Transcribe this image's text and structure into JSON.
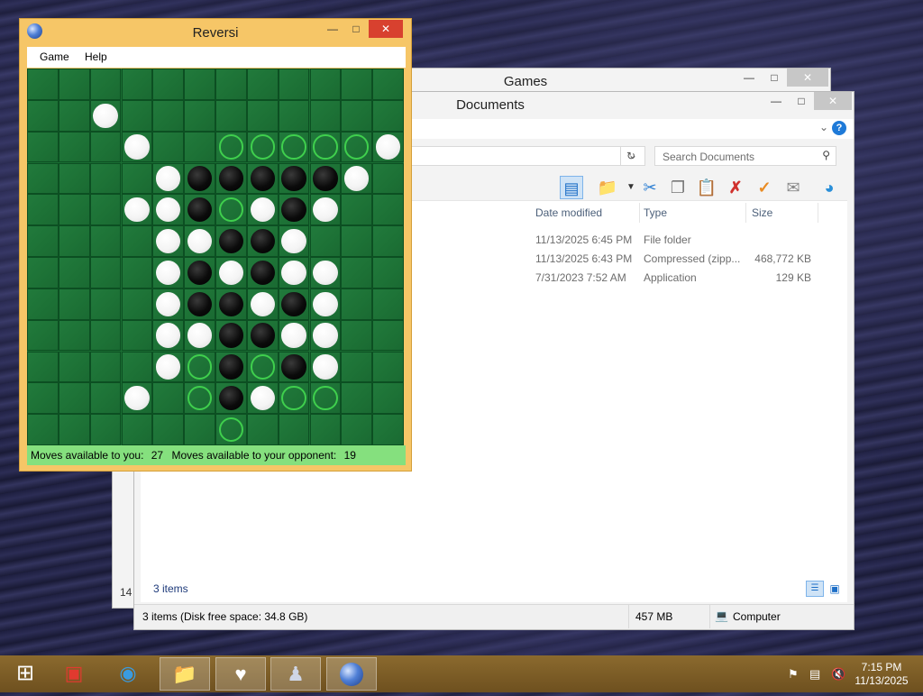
{
  "games_window": {
    "title": "Games",
    "left_count": "14",
    "item_count": "3 items"
  },
  "documents_window": {
    "title": "Documents",
    "search_placeholder": "Search Documents",
    "columns": {
      "date": "Date modified",
      "type": "Type",
      "size": "Size"
    },
    "rows": [
      {
        "date": "11/13/2025 6:45 PM",
        "type": "File folder",
        "size": ""
      },
      {
        "date": "11/13/2025 6:43 PM",
        "type": "Compressed (zipp...",
        "size": "468,772 KB"
      },
      {
        "date": "7/31/2023 7:52 AM",
        "type": "Application",
        "size": "129 KB"
      }
    ],
    "status": {
      "items": "3 items (Disk free space: 34.8 GB)",
      "size": "457 MB",
      "location": "Computer"
    }
  },
  "reversi": {
    "title": "Reversi",
    "menu": {
      "game": "Game",
      "help": "Help"
    },
    "status_you_label": "Moves available to you:",
    "status_you_value": "27",
    "status_opp_label": "Moves available to your opponent:",
    "status_opp_value": "19",
    "board": [
      "............",
      "..W.........",
      "...W..HHHHHW",
      "....WBBBBBW.",
      "...WWBHWBW..",
      "....WWBBW...",
      "....WBWBWW..",
      "....WBBWBW..",
      "....WWBBWW..",
      "....WHBHBW..",
      "...W.HBWHH..",
      "......H....."
    ]
  },
  "taskbar": {
    "clock_time": "7:15 PM",
    "clock_date": "11/13/2025",
    "apps": [
      "start-icon",
      "gift-box-icon",
      "globe-browser-icon",
      "file-explorer-icon",
      "heart-shield-icon",
      "chess-icon",
      "reversi-icon"
    ]
  },
  "colors": {
    "board_green": "#1d7236",
    "hint_green": "#3fcf4d",
    "frame_orange": "#f6c667",
    "taskbar": "#7a5a24"
  }
}
